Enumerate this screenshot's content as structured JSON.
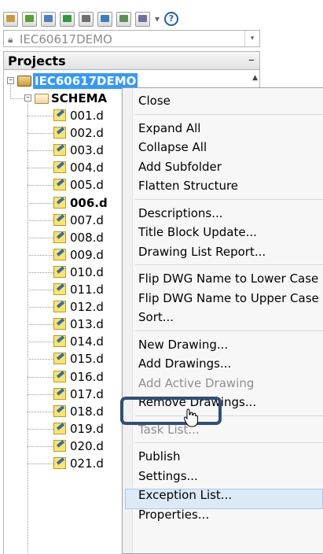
{
  "toolbar": {
    "buttons": [
      {
        "name": "open-project-icon",
        "color": "#c99a3c"
      },
      {
        "name": "new-project-icon",
        "color": "#5aa02c"
      },
      {
        "name": "new-drawing-icon",
        "color": "#4f7fbf"
      },
      {
        "name": "refresh-icon",
        "color": "#2f9a3a"
      },
      {
        "name": "previous-drawing-icon",
        "color": "#6f6f6f"
      },
      {
        "name": "next-drawing-icon",
        "color": "#3a7fbf"
      },
      {
        "name": "project-properties-icon",
        "color": "#5a8f5a"
      },
      {
        "name": "publish-plot-icon",
        "color": "#6f6f9f"
      }
    ],
    "dropdown_arrow": "▾",
    "help_label": "?"
  },
  "project_combo": {
    "value": "IEC60617DEMO",
    "lock_icon": "lock-icon",
    "arrow": "▾"
  },
  "projects_panel": {
    "title": "Projects",
    "minimize": "–",
    "scroll_up": "▲"
  },
  "tree": {
    "project": {
      "label": "IEC60617DEMO",
      "expander": "–"
    },
    "folder": {
      "label": "SCHEMA",
      "expander": "–"
    },
    "drawings": [
      {
        "label": "001.d",
        "bold": false
      },
      {
        "label": "002.d",
        "bold": false
      },
      {
        "label": "003.d",
        "bold": false
      },
      {
        "label": "004.d",
        "bold": false
      },
      {
        "label": "005.d",
        "bold": false
      },
      {
        "label": "006.d",
        "bold": true
      },
      {
        "label": "007.d",
        "bold": false
      },
      {
        "label": "008.d",
        "bold": false
      },
      {
        "label": "009.d",
        "bold": false
      },
      {
        "label": "010.d",
        "bold": false
      },
      {
        "label": "011.d",
        "bold": false
      },
      {
        "label": "012.d",
        "bold": false
      },
      {
        "label": "013.d",
        "bold": false
      },
      {
        "label": "014.d",
        "bold": false
      },
      {
        "label": "015.d",
        "bold": false
      },
      {
        "label": "016.d",
        "bold": false
      },
      {
        "label": "017.d",
        "bold": false
      },
      {
        "label": "018.d",
        "bold": false
      },
      {
        "label": "019.d",
        "bold": false
      },
      {
        "label": "020.d",
        "bold": false
      },
      {
        "label": "021.d",
        "bold": false
      }
    ]
  },
  "context_menu": {
    "groups": [
      {
        "items": [
          {
            "label": "Close",
            "enabled": true
          }
        ]
      },
      {
        "items": [
          {
            "label": "Expand All",
            "enabled": true
          },
          {
            "label": "Collapse All",
            "enabled": true
          },
          {
            "label": "Add Subfolder",
            "enabled": true
          },
          {
            "label": "Flatten Structure",
            "enabled": true
          }
        ]
      },
      {
        "items": [
          {
            "label": "Descriptions...",
            "enabled": true
          },
          {
            "label": "Title Block Update...",
            "enabled": true
          },
          {
            "label": "Drawing List Report...",
            "enabled": true
          }
        ]
      },
      {
        "items": [
          {
            "label": "Flip DWG Name to Lower Case",
            "enabled": true
          },
          {
            "label": "Flip DWG Name to Upper Case",
            "enabled": true
          },
          {
            "label": "Sort...",
            "enabled": true
          }
        ]
      },
      {
        "items": [
          {
            "label": "New Drawing...",
            "enabled": true
          },
          {
            "label": "Add Drawings...",
            "enabled": true
          },
          {
            "label": "Add Active Drawing",
            "enabled": false
          },
          {
            "label": "Remove Drawings...",
            "enabled": true
          }
        ]
      },
      {
        "items": [
          {
            "label": "Task List...",
            "enabled": false
          }
        ]
      },
      {
        "items": [
          {
            "label": "Publish",
            "enabled": true
          },
          {
            "label": "Settings...",
            "enabled": true,
            "highlighted": true
          },
          {
            "label": "Exception List...",
            "enabled": true
          },
          {
            "label": "Properties...",
            "enabled": true
          }
        ]
      }
    ]
  },
  "colors": {
    "selection": "#3399ff",
    "highlight_ring": "#2f4f7a",
    "menu_hover": "#dceaf8"
  }
}
